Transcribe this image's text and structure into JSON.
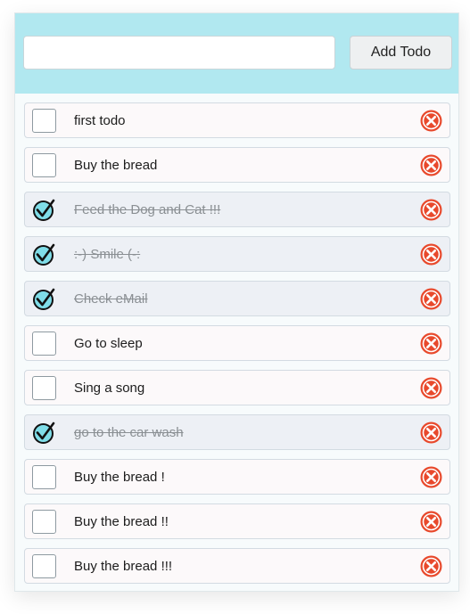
{
  "header": {
    "input_value": "",
    "input_placeholder": "",
    "add_label": "Add Todo"
  },
  "todos": [
    {
      "text": "first todo",
      "done": false
    },
    {
      "text": "Buy the bread",
      "done": false
    },
    {
      "text": "Feed the Dog and Cat !!!",
      "done": true
    },
    {
      "text": ":-) Smile (-:",
      "done": true
    },
    {
      "text": "Check eMail",
      "done": true
    },
    {
      "text": "Go to sleep",
      "done": false
    },
    {
      "text": "Sing a song",
      "done": false
    },
    {
      "text": "go to the car wash",
      "done": true
    },
    {
      "text": "Buy the bread !",
      "done": false
    },
    {
      "text": "Buy the bread !!",
      "done": false
    },
    {
      "text": "Buy the bread !!!",
      "done": false
    }
  ],
  "colors": {
    "header_bg": "#b1e8f0",
    "check_fill": "#7fdde8",
    "delete_red": "#e8492c"
  },
  "icons": {
    "checked": "check-circle-icon",
    "delete": "delete-x-icon"
  }
}
